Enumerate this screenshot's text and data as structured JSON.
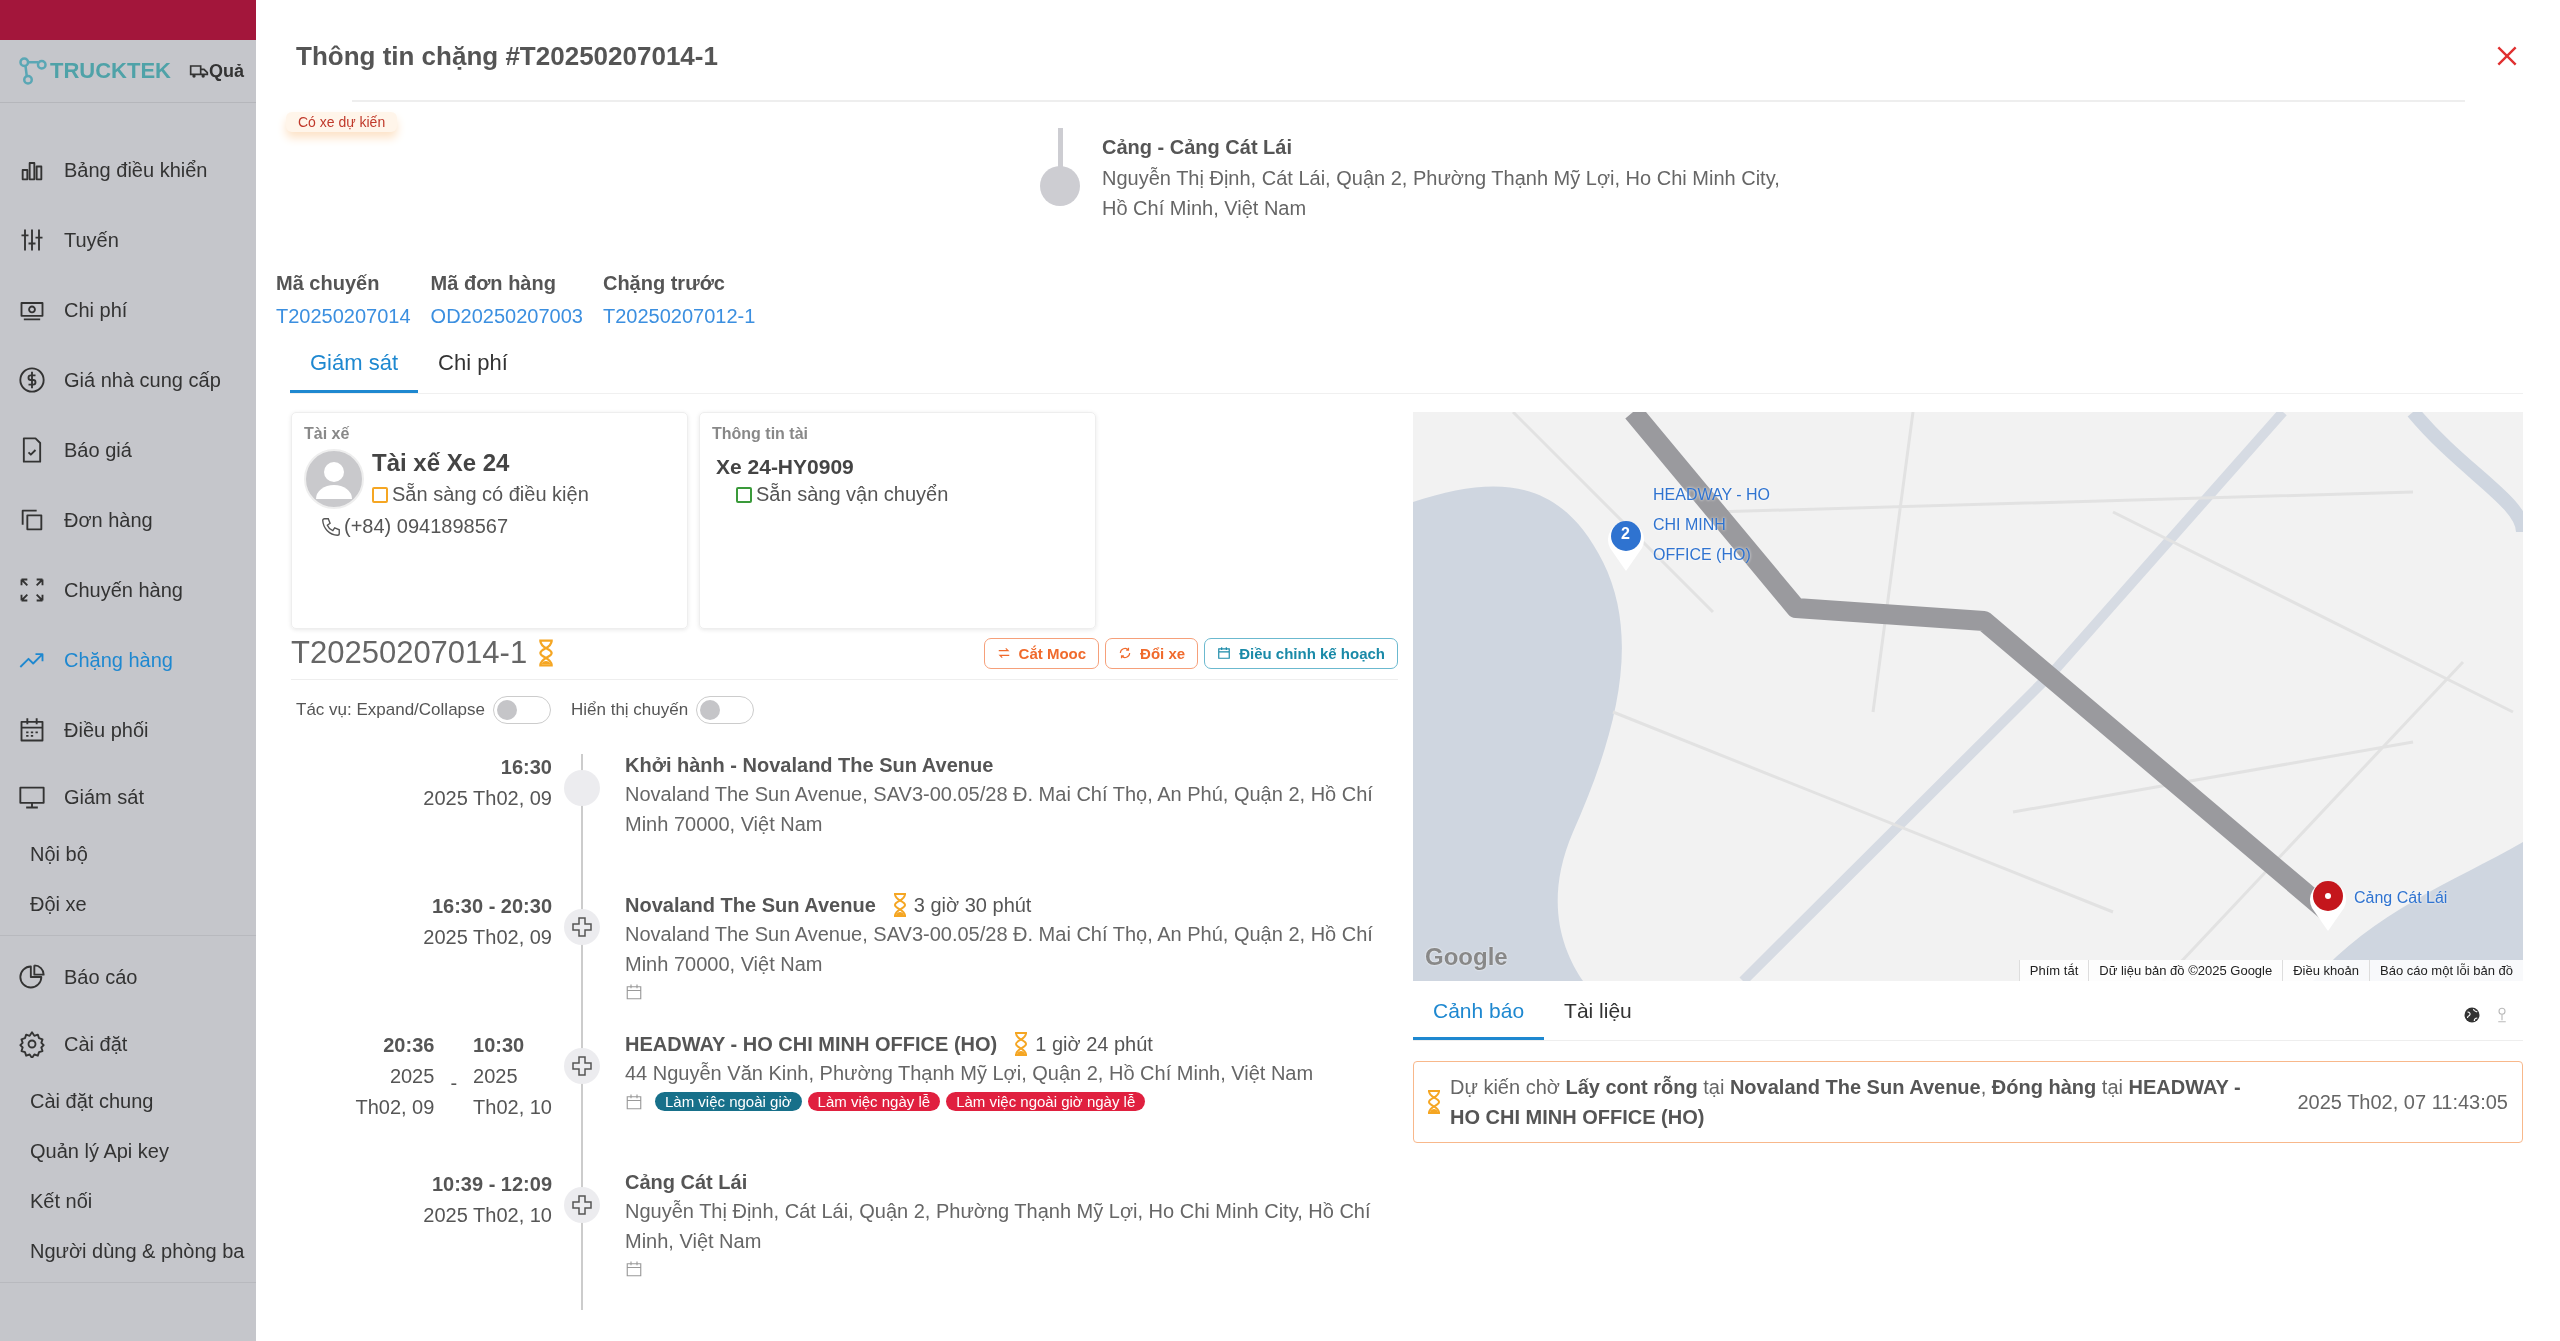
{
  "sidebar": {
    "logo": "TRUCKTEK",
    "top_link": "Quả",
    "items": [
      {
        "label": "Bảng điều khiển",
        "selected": false
      },
      {
        "label": "Tuyến",
        "selected": false
      },
      {
        "label": "Chi phí",
        "selected": false
      },
      {
        "label": "Giá nhà cung cấp",
        "selected": false
      },
      {
        "label": "Báo giá",
        "selected": false
      },
      {
        "label": "Đơn hàng",
        "selected": false
      },
      {
        "label": "Chuyến hàng",
        "selected": false
      },
      {
        "label": "Chặng hàng",
        "selected": true
      },
      {
        "label": "Điều phối",
        "selected": false
      },
      {
        "label": "Giám sát",
        "selected": false,
        "children": [
          {
            "label": "Nội bộ",
            "selected": false
          },
          {
            "label": "Đội xe",
            "selected": false
          }
        ]
      },
      {
        "label": "Báo cáo",
        "selected": false
      },
      {
        "label": "Cài đặt",
        "selected": false,
        "children": [
          {
            "label": "Cài đặt chung",
            "selected": false
          },
          {
            "label": "Quản lý Api key",
            "selected": false
          },
          {
            "label": "Kết nối",
            "selected": false
          },
          {
            "label": "Người dùng & phòng ba",
            "selected": false
          }
        ]
      }
    ]
  },
  "drawer": {
    "title": "Thông tin chặng #T20250207014-1",
    "eta_badge": "Có xe dự kiến",
    "destination": {
      "title": "Cảng - Cảng Cát Lái",
      "address": "Nguyễn Thị Định, Cát Lái, Quận 2, Phường Thạnh Mỹ Lợi, Ho Chi Minh City, Hồ Chí Minh, Việt Nam"
    },
    "meta": [
      {
        "label": "Mã chuyến",
        "value": "T20250207014"
      },
      {
        "label": "Mã đơn hàng",
        "value": "OD20250207003"
      },
      {
        "label": "Chặng trước",
        "value": "T20250207012-1"
      }
    ],
    "tabs": [
      {
        "label": "Giám sát",
        "selected": true
      },
      {
        "label": "Chi phí",
        "selected": false
      }
    ],
    "driver_card": {
      "heading": "Tài xế",
      "name": "Tài xế Xe 24",
      "status": {
        "label": "Sẵn sàng có điều kiện",
        "color": "#f5a623"
      },
      "phone": "(+84) 0941898567"
    },
    "vehicle_card": {
      "heading": "Thông tin tài",
      "name": "Xe 24-HY0909",
      "status": {
        "label": "Sẵn sàng vận chuyển",
        "color": "#3a9a3a"
      }
    },
    "trip": {
      "code": "T20250207014-1",
      "actions": [
        {
          "label": "Cắt Mooc",
          "kind": "swap"
        },
        {
          "label": "Đổi xe",
          "kind": "change"
        },
        {
          "label": "Điều chỉnh kế hoạch",
          "kind": "plan"
        }
      ]
    },
    "toggles": [
      {
        "label": "Tác vụ: Expand/Collapse",
        "on": false
      },
      {
        "label": "Hiển thị chuyến",
        "on": false
      }
    ],
    "timeline": [
      {
        "kind": "start",
        "time": {
          "kind": "single",
          "time": "16:30",
          "date": "2025 Th02, 09"
        },
        "title": "Khởi hành - Novaland The Sun Avenue",
        "address": "Novaland The Sun Avenue, SAV3-00.05/28 Đ. Mai Chí Thọ, An Phú, Quận 2, Hồ Chí Minh 70000, Việt Nam"
      },
      {
        "kind": "stop",
        "time": {
          "kind": "single",
          "time": "16:30 - 20:30",
          "date": "2025 Th02, 09"
        },
        "title": "Novaland The Sun Avenue",
        "duration": "3 giờ 30 phút",
        "address": "Novaland The Sun Avenue, SAV3-00.05/28 Đ. Mai Chí Thọ, An Phú, Quận 2, Hồ Chí Minh 70000, Việt Nam"
      },
      {
        "kind": "stop",
        "time": {
          "kind": "split",
          "from": {
            "time": "20:36",
            "year": "2025",
            "day": "Th02, 09"
          },
          "separator": "-",
          "to": {
            "time": "10:30",
            "year": "2025",
            "day": "Th02, 10"
          }
        },
        "title": "HEADWAY - HO CHI MINH OFFICE (HO)",
        "duration": "1 giờ 24 phút",
        "address": "44 Nguyễn Văn Kinh, Phường Thạnh Mỹ Lợi, Quận 2, Hồ Chí Minh, Việt Nam",
        "tags": [
          {
            "label": "Làm việc ngoài giờ",
            "color": "#17708a"
          },
          {
            "label": "Làm việc ngày lễ",
            "color": "#e0203f"
          },
          {
            "label": "Làm việc ngoài giờ ngày lễ",
            "color": "#e0203f"
          }
        ]
      },
      {
        "kind": "stop",
        "time": {
          "kind": "single",
          "time": "10:39 - 12:09",
          "date": "2025 Th02, 10"
        },
        "title": "Cảng Cát Lái",
        "address": "Nguyễn Thị Định, Cát Lái, Quận 2, Phường Thạnh Mỹ Lợi, Ho Chi Minh City, Hồ Chí Minh, Việt Nam"
      }
    ],
    "map": {
      "markers": [
        {
          "kind": "stop",
          "number": "2",
          "label": "HEADWAY - HO CHI MINH OFFICE (HO)"
        },
        {
          "kind": "destination",
          "label": "Cảng Cát Lái"
        }
      ],
      "logo": "Google",
      "footer": [
        "Phím tắt",
        "Dữ liệu bản đồ ©2025 Google",
        "Điều khoản",
        "Báo cáo một lỗi bản đồ"
      ]
    },
    "bottom_tabs": [
      {
        "label": "Cảnh báo",
        "selected": true
      },
      {
        "label": "Tài liệu",
        "selected": false
      }
    ],
    "alerts": [
      {
        "text": "Dự kiến chờ **Lấy cont rỗng** tại **Novaland The Sun Avenue**, **Đóng hàng** tại **HEADWAY - HO CHI MINH OFFICE (HO)**",
        "time": "2025 Th02, 07 11:43:05"
      }
    ]
  }
}
